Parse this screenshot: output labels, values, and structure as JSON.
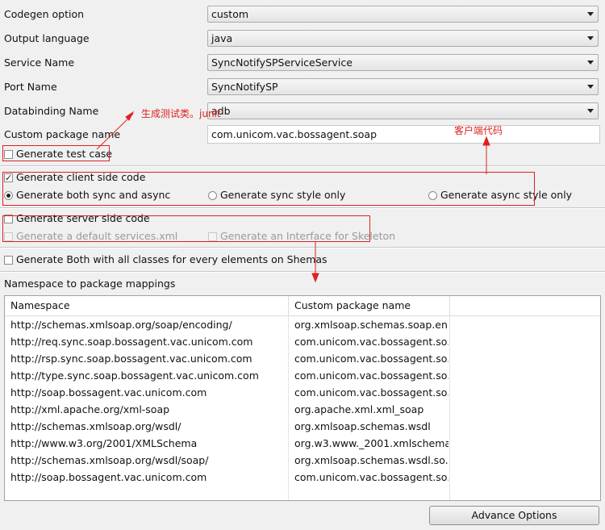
{
  "form": {
    "codegen_option": {
      "label": "Codegen option",
      "value": "custom"
    },
    "output_language": {
      "label": "Output language",
      "value": "java"
    },
    "service_name": {
      "label": "Service Name",
      "value": "SyncNotifySPServiceService"
    },
    "port_name": {
      "label": "Port Name",
      "value": "SyncNotifySP"
    },
    "databinding_name": {
      "label": "Databinding Name",
      "value": "adb"
    },
    "custom_package": {
      "label": "Custom package name",
      "value": "com.unicom.vac.bossagent.soap"
    }
  },
  "options": {
    "test_case": {
      "label": "Generate test case",
      "checked": false
    },
    "client_side": {
      "label": "Generate client side code",
      "checked": true
    },
    "both_sync_async": {
      "label": "Generate both sync and async",
      "selected": true
    },
    "sync_only": {
      "label": "Generate sync style only",
      "selected": false
    },
    "async_only": {
      "label": "Generate async style only",
      "selected": false
    },
    "server_side": {
      "label": "Generate server side code",
      "checked": false
    },
    "default_services": {
      "label": "Generate a default services.xml",
      "enabled": false
    },
    "interface_skeleton": {
      "label": "Generate an Interface for Skeleton",
      "enabled": false
    },
    "all_classes": {
      "label": "Generate Both with all classes for every elements on Shemas",
      "checked": false
    }
  },
  "namespace_section": {
    "title": "Namespace to package mappings",
    "columns": [
      "Namespace",
      "Custom package name"
    ],
    "rows": [
      [
        "http://schemas.xmlsoap.org/soap/encoding/",
        "org.xmlsoap.schemas.soap.en..."
      ],
      [
        "http://req.sync.soap.bossagent.vac.unicom.com",
        "com.unicom.vac.bossagent.so..."
      ],
      [
        "http://rsp.sync.soap.bossagent.vac.unicom.com",
        "com.unicom.vac.bossagent.so..."
      ],
      [
        "http://type.sync.soap.bossagent.vac.unicom.com",
        "com.unicom.vac.bossagent.so..."
      ],
      [
        "http://soap.bossagent.vac.unicom.com",
        "com.unicom.vac.bossagent.so..."
      ],
      [
        "http://xml.apache.org/xml-soap",
        "org.apache.xml.xml_soap"
      ],
      [
        "http://schemas.xmlsoap.org/wsdl/",
        "org.xmlsoap.schemas.wsdl"
      ],
      [
        "http://www.w3.org/2001/XMLSchema",
        "org.w3.www._2001.xmlschema"
      ],
      [
        "http://schemas.xmlsoap.org/wsdl/soap/",
        "org.xmlsoap.schemas.wsdl.so..."
      ],
      [
        "http://soap.bossagent.vac.unicom.com",
        "com.unicom.vac.bossagent.so..."
      ]
    ]
  },
  "buttons": {
    "advance_options": "Advance Options"
  },
  "annotations": {
    "test_class": "生成测试类。junit",
    "client_code": "客户端代码"
  },
  "colors": {
    "annotation": "#e02020",
    "background": "#f0f0f0"
  }
}
